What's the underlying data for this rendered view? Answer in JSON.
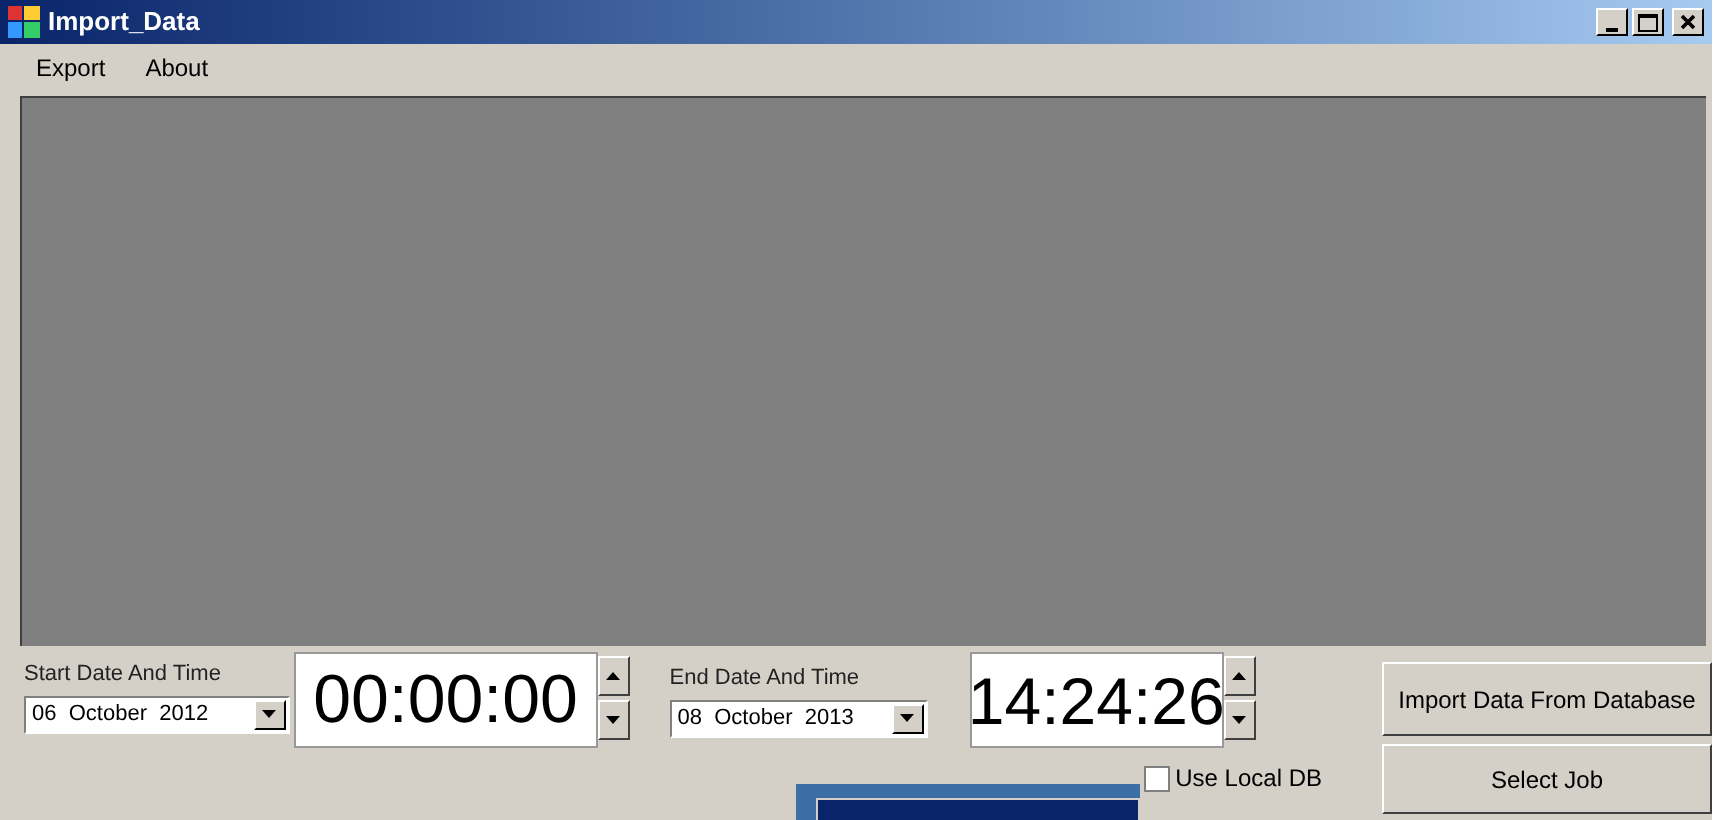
{
  "window": {
    "title": "Import_Data"
  },
  "menu": [
    {
      "label": "Export"
    },
    {
      "label": "About"
    }
  ],
  "start": {
    "label": "Start Date And Time",
    "date": "06  October  2012",
    "time": "00:00:00"
  },
  "end": {
    "label": "End Date And Time",
    "date": "08  October  2013",
    "time": "14:24:26"
  },
  "use_local_db": {
    "label": "Use Local DB",
    "checked": false
  },
  "buttons": [
    {
      "label": "Import Data From Database"
    },
    {
      "label": "Select Job"
    }
  ]
}
